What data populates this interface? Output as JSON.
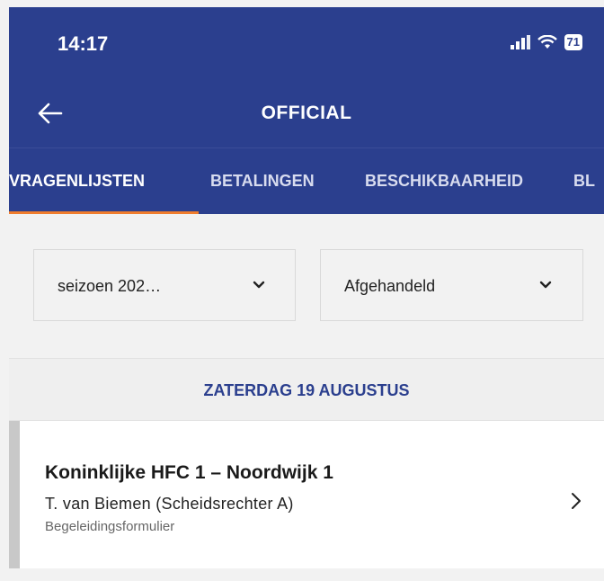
{
  "status_bar": {
    "time": "14:17",
    "battery": "71"
  },
  "header": {
    "title": "OFFICIAL"
  },
  "tabs": [
    {
      "label": "VRAGENLIJSTEN",
      "active": true
    },
    {
      "label": "BETALINGEN",
      "active": false
    },
    {
      "label": "BESCHIKBAARHEID",
      "active": false
    },
    {
      "label": "BL",
      "active": false
    }
  ],
  "filters": {
    "season": "seizoen 202…",
    "status": "Afgehandeld"
  },
  "date_header": "ZATERDAG 19 AUGUSTUS",
  "match": {
    "title": "Koninklijke HFC 1 – Noordwijk 1",
    "official": "T. van Biemen (Scheidsrechter A)",
    "form": "Begeleidingsformulier"
  },
  "colors": {
    "primary": "#2b3f8e",
    "accent": "#f07d2e"
  }
}
